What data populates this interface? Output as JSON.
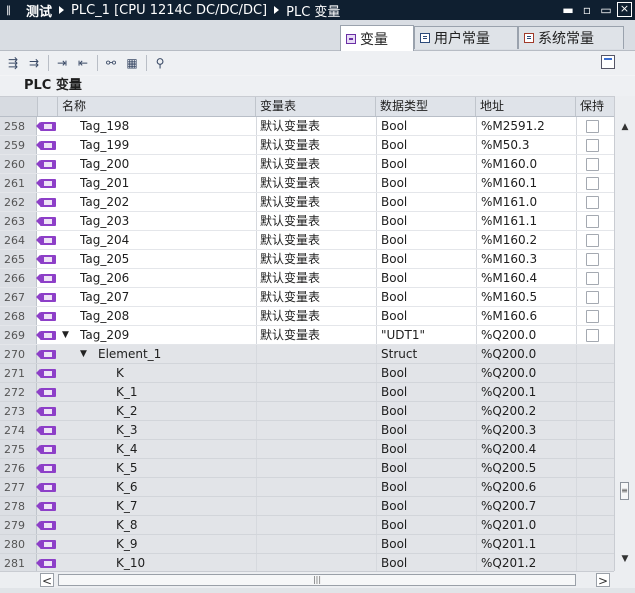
{
  "titlebar": {
    "pin": "‖",
    "project": "测试",
    "device": "PLC_1 [CPU 1214C DC/DC/DC]",
    "section": "PLC 变量"
  },
  "tabs": [
    {
      "label": "变量",
      "active": true
    },
    {
      "label": "用户常量",
      "active": false
    },
    {
      "label": "系统常量",
      "active": false
    }
  ],
  "section_title": "PLC 变量",
  "columns": {
    "name": "名称",
    "table": "变量表",
    "type": "数据类型",
    "address": "地址",
    "retain": "保持"
  },
  "rows": [
    {
      "num": "258",
      "name": "Tag_198",
      "table": "默认变量表",
      "type": "Bool",
      "address": "%M2591.2",
      "level": 0,
      "expand": "",
      "checkbox": true
    },
    {
      "num": "259",
      "name": "Tag_199",
      "table": "默认变量表",
      "type": "Bool",
      "address": "%M50.3",
      "level": 0,
      "expand": "",
      "checkbox": true
    },
    {
      "num": "260",
      "name": "Tag_200",
      "table": "默认变量表",
      "type": "Bool",
      "address": "%M160.0",
      "level": 0,
      "expand": "",
      "checkbox": true
    },
    {
      "num": "261",
      "name": "Tag_201",
      "table": "默认变量表",
      "type": "Bool",
      "address": "%M160.1",
      "level": 0,
      "expand": "",
      "checkbox": true
    },
    {
      "num": "262",
      "name": "Tag_202",
      "table": "默认变量表",
      "type": "Bool",
      "address": "%M161.0",
      "level": 0,
      "expand": "",
      "checkbox": true
    },
    {
      "num": "263",
      "name": "Tag_203",
      "table": "默认变量表",
      "type": "Bool",
      "address": "%M161.1",
      "level": 0,
      "expand": "",
      "checkbox": true
    },
    {
      "num": "264",
      "name": "Tag_204",
      "table": "默认变量表",
      "type": "Bool",
      "address": "%M160.2",
      "level": 0,
      "expand": "",
      "checkbox": true
    },
    {
      "num": "265",
      "name": "Tag_205",
      "table": "默认变量表",
      "type": "Bool",
      "address": "%M160.3",
      "level": 0,
      "expand": "",
      "checkbox": true
    },
    {
      "num": "266",
      "name": "Tag_206",
      "table": "默认变量表",
      "type": "Bool",
      "address": "%M160.4",
      "level": 0,
      "expand": "",
      "checkbox": true
    },
    {
      "num": "267",
      "name": "Tag_207",
      "table": "默认变量表",
      "type": "Bool",
      "address": "%M160.5",
      "level": 0,
      "expand": "",
      "checkbox": true
    },
    {
      "num": "268",
      "name": "Tag_208",
      "table": "默认变量表",
      "type": "Bool",
      "address": "%M160.6",
      "level": 0,
      "expand": "",
      "checkbox": true
    },
    {
      "num": "269",
      "name": "Tag_209",
      "table": "默认变量表",
      "type": "\"UDT1\"",
      "address": "%Q200.0",
      "level": 0,
      "expand": "▼",
      "checkbox": true
    },
    {
      "num": "270",
      "name": "Element_1",
      "table": "",
      "type": "Struct",
      "address": "%Q200.0",
      "level": 1,
      "expand": "▼",
      "checkbox": false
    },
    {
      "num": "271",
      "name": "K",
      "table": "",
      "type": "Bool",
      "address": "%Q200.0",
      "level": 2,
      "expand": "",
      "checkbox": false
    },
    {
      "num": "272",
      "name": "K_1",
      "table": "",
      "type": "Bool",
      "address": "%Q200.1",
      "level": 2,
      "expand": "",
      "checkbox": false
    },
    {
      "num": "273",
      "name": "K_2",
      "table": "",
      "type": "Bool",
      "address": "%Q200.2",
      "level": 2,
      "expand": "",
      "checkbox": false
    },
    {
      "num": "274",
      "name": "K_3",
      "table": "",
      "type": "Bool",
      "address": "%Q200.3",
      "level": 2,
      "expand": "",
      "checkbox": false
    },
    {
      "num": "275",
      "name": "K_4",
      "table": "",
      "type": "Bool",
      "address": "%Q200.4",
      "level": 2,
      "expand": "",
      "checkbox": false
    },
    {
      "num": "276",
      "name": "K_5",
      "table": "",
      "type": "Bool",
      "address": "%Q200.5",
      "level": 2,
      "expand": "",
      "checkbox": false
    },
    {
      "num": "277",
      "name": "K_6",
      "table": "",
      "type": "Bool",
      "address": "%Q200.6",
      "level": 2,
      "expand": "",
      "checkbox": false
    },
    {
      "num": "278",
      "name": "K_7",
      "table": "",
      "type": "Bool",
      "address": "%Q200.7",
      "level": 2,
      "expand": "",
      "checkbox": false
    },
    {
      "num": "279",
      "name": "K_8",
      "table": "",
      "type": "Bool",
      "address": "%Q201.0",
      "level": 2,
      "expand": "",
      "checkbox": false
    },
    {
      "num": "280",
      "name": "K_9",
      "table": "",
      "type": "Bool",
      "address": "%Q201.1",
      "level": 2,
      "expand": "",
      "checkbox": false
    },
    {
      "num": "281",
      "name": "K_10",
      "table": "",
      "type": "Bool",
      "address": "%Q201.2",
      "level": 2,
      "expand": "",
      "checkbox": false
    }
  ],
  "scroll": {
    "up": "▲",
    "down": "▼",
    "left": "<",
    "right": ">"
  },
  "window_buttons": {
    "minimize": "▬",
    "restore": "▫",
    "maximize": "▭",
    "close": "×"
  },
  "toolbar_icons": [
    "add-tag-icon",
    "remove-tag-icon",
    "export-icon",
    "import-icon",
    "monitor-icon",
    "setpoint-icon",
    "search-icon"
  ],
  "colors": {
    "titlebar": "#0f1f30",
    "tag_icon": "#8d3fc8",
    "subrow": "#e2e4e8"
  }
}
